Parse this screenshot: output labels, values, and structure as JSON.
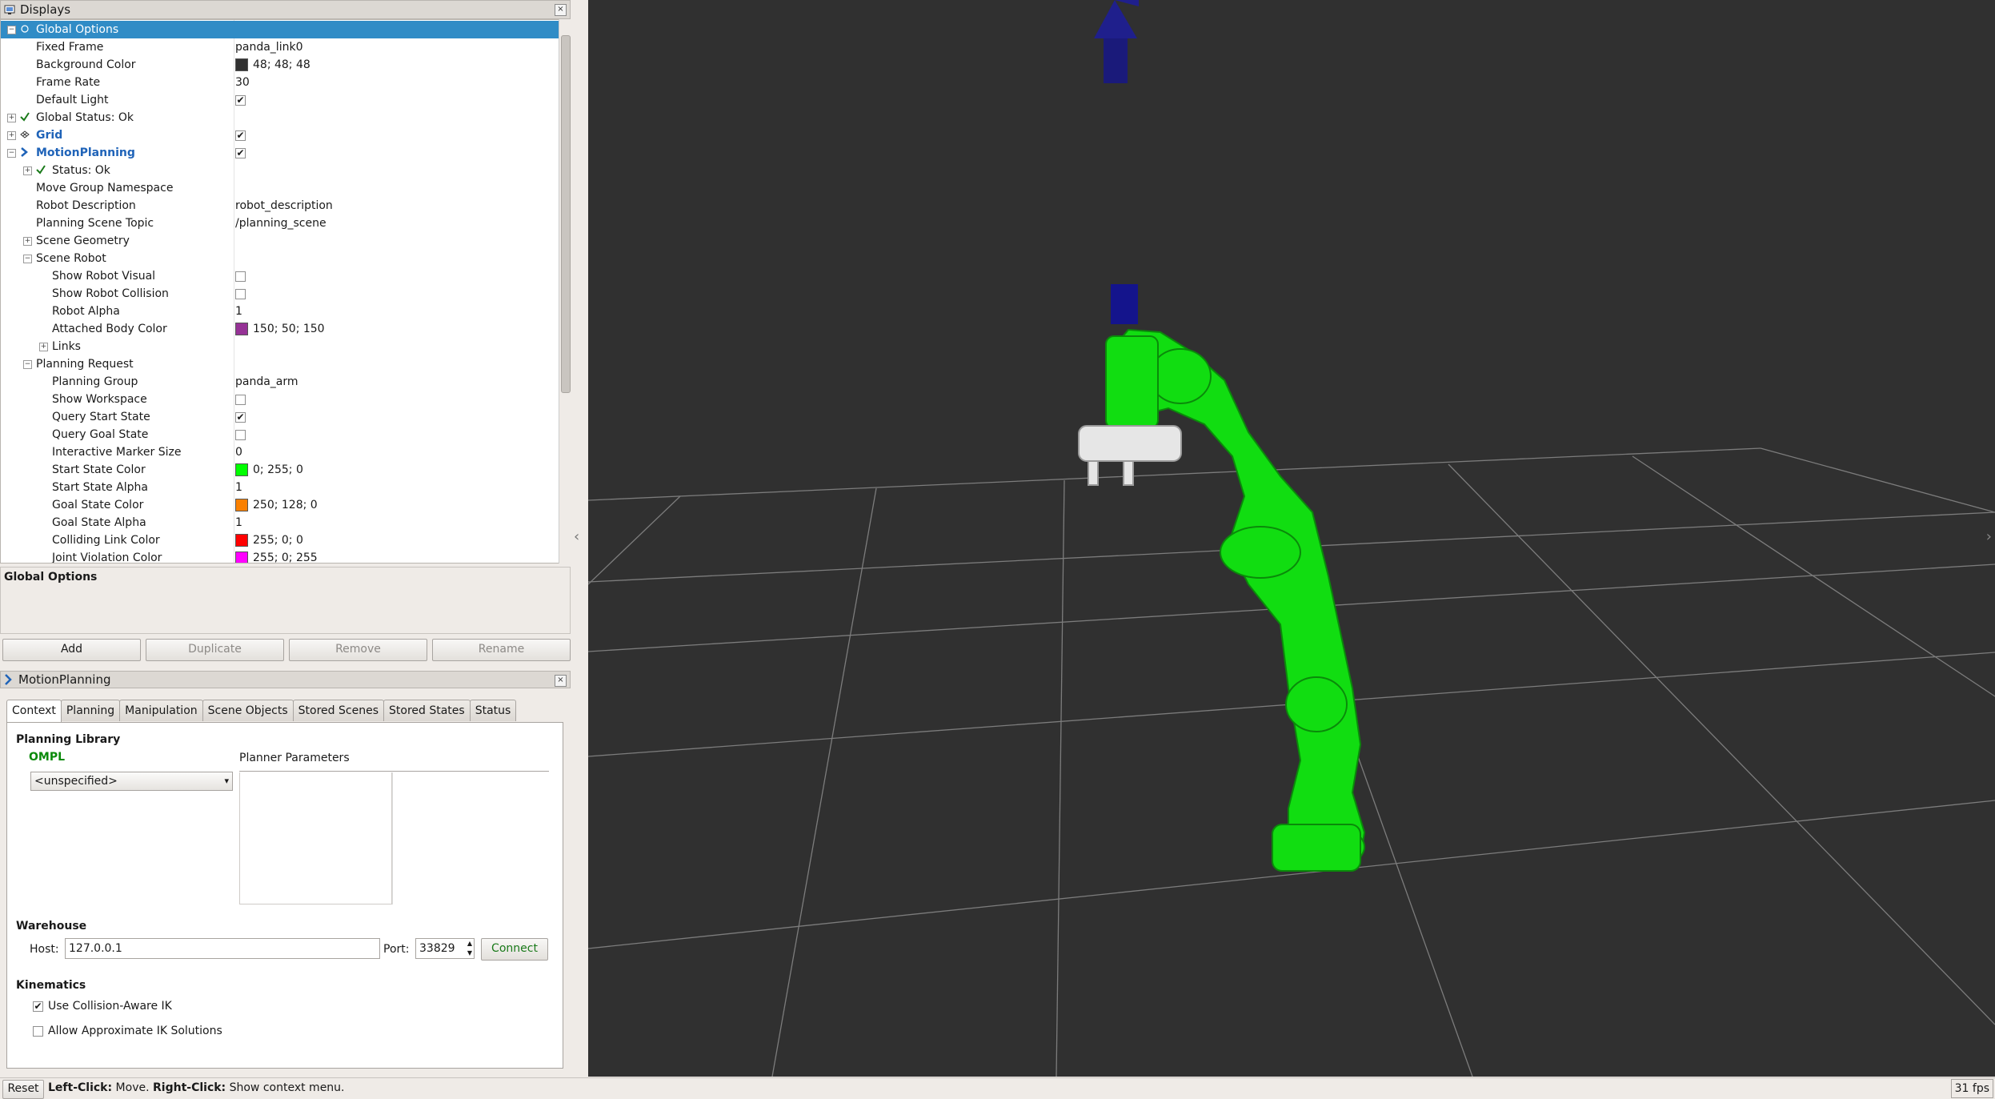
{
  "displays": {
    "title": "Displays",
    "close": "×",
    "rows": [
      {
        "label": "Global Options",
        "indent": 0,
        "expander": "−",
        "selected": true,
        "icon": "globe-icon"
      },
      {
        "label": "Fixed Frame",
        "value": "panda_link0",
        "indent": 1
      },
      {
        "label": "Background Color",
        "value": "48; 48; 48",
        "swatch": "#303030",
        "indent": 1
      },
      {
        "label": "Frame Rate",
        "value": "30",
        "indent": 1
      },
      {
        "label": "Default Light",
        "check": "✔",
        "indent": 1
      },
      {
        "label": "Global Status: Ok",
        "indent": 0,
        "expander": "+",
        "icon": "checkmark-icon"
      },
      {
        "label": "Grid",
        "indent": 0,
        "expander": "+",
        "icon": "grid-icon",
        "blue": true,
        "check": "✔"
      },
      {
        "label": "MotionPlanning",
        "indent": 0,
        "expander": "−",
        "icon": "motion-planning-icon",
        "blue": true,
        "check": "✔"
      },
      {
        "label": "Status: Ok",
        "indent": 1,
        "expander": "+",
        "icon": "checkmark-icon"
      },
      {
        "label": "Move Group Namespace",
        "indent": 1
      },
      {
        "label": "Robot Description",
        "value": "robot_description",
        "indent": 1
      },
      {
        "label": "Planning Scene Topic",
        "value": "/planning_scene",
        "indent": 1
      },
      {
        "label": "Scene Geometry",
        "indent": 1,
        "expander": "+"
      },
      {
        "label": "Scene Robot",
        "indent": 1,
        "expander": "−"
      },
      {
        "label": "Show Robot Visual",
        "check": "",
        "indent": 2
      },
      {
        "label": "Show Robot Collision",
        "check": "",
        "indent": 2
      },
      {
        "label": "Robot Alpha",
        "value": "1",
        "indent": 2
      },
      {
        "label": "Attached Body Color",
        "value": "150; 50; 150",
        "swatch": "#963296",
        "indent": 2
      },
      {
        "label": "Links",
        "indent": 2,
        "expander": "+"
      },
      {
        "label": "Planning Request",
        "indent": 1,
        "expander": "−"
      },
      {
        "label": "Planning Group",
        "value": "panda_arm",
        "indent": 2
      },
      {
        "label": "Show Workspace",
        "check": "",
        "indent": 2
      },
      {
        "label": "Query Start State",
        "check": "✔",
        "indent": 2
      },
      {
        "label": "Query Goal State",
        "check": "",
        "indent": 2
      },
      {
        "label": "Interactive Marker Size",
        "value": "0",
        "indent": 2
      },
      {
        "label": "Start State Color",
        "value": "0; 255; 0",
        "swatch": "#00ff00",
        "indent": 2
      },
      {
        "label": "Start State Alpha",
        "value": "1",
        "indent": 2
      },
      {
        "label": "Goal State Color",
        "value": "250; 128; 0",
        "swatch": "#fa8000",
        "indent": 2
      },
      {
        "label": "Goal State Alpha",
        "value": "1",
        "indent": 2
      },
      {
        "label": "Colliding Link Color",
        "value": "255; 0; 0",
        "swatch": "#ff0000",
        "indent": 2
      },
      {
        "label": "Joint Violation Color",
        "value": "255; 0; 255",
        "swatch": "#ff00ff",
        "indent": 2
      }
    ]
  },
  "description": {
    "title": "Global Options"
  },
  "buttons": {
    "add": "Add",
    "duplicate": "Duplicate",
    "remove": "Remove",
    "rename": "Rename"
  },
  "motion_planning": {
    "title": "MotionPlanning",
    "close": "×",
    "tabs": [
      "Context",
      "Planning",
      "Manipulation",
      "Scene Objects",
      "Stored Scenes",
      "Stored States",
      "Status"
    ],
    "planning_library": "Planning Library",
    "library_name": "OMPL",
    "planner_select": "<unspecified>",
    "planner_parameters": "Planner Parameters",
    "warehouse": "Warehouse",
    "host_label": "Host:",
    "host_value": "127.0.0.1",
    "port_label": "Port:",
    "port_value": "33829",
    "connect": "Connect",
    "kinematics": "Kinematics",
    "use_collision_aware_ik": "Use Collision-Aware IK",
    "allow_approx_ik": "Allow Approximate IK Solutions",
    "use_collision_check": "✔"
  },
  "viewport": {
    "fps": "31 fps",
    "left_arrow": "‹",
    "right_arrow": "›"
  },
  "status": {
    "reset": "Reset",
    "left_click": "Left-Click:",
    "move": "Move.",
    "right_click": "Right-Click:",
    "context": "Show context menu."
  },
  "colors": {
    "background": "#303030",
    "robot": "#00ff00",
    "arrow": "#1a1a9a",
    "selection": "#308cc6"
  }
}
